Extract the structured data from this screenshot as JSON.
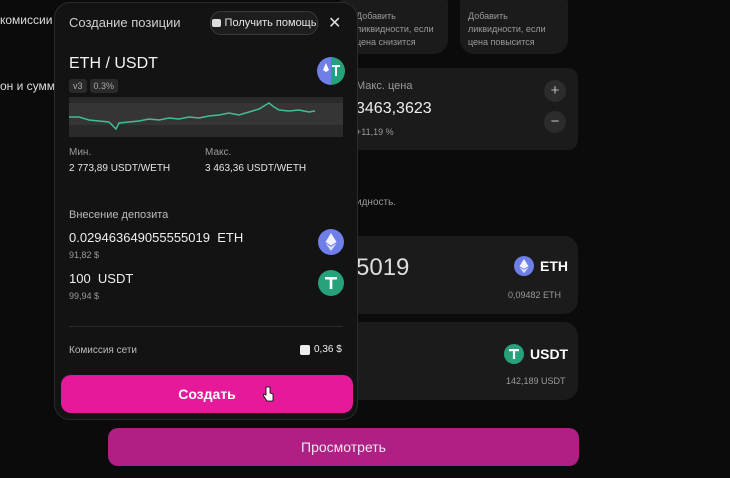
{
  "background": {
    "left_text_1": "комиссии",
    "left_text_2": "он и сумм",
    "card_low_text": "Добавить ликвидности, если цена снизится",
    "card_high_text": "Добавить ликвидности, если цена повысится",
    "max_price_label": "Макс. цена",
    "max_price_value": "3463,3623",
    "max_price_change": "+11,19 %",
    "liquidity_text": "идность.",
    "eth_amount_partial": "5019",
    "eth_token": "ETH",
    "eth_balance": "0,09482 ETH",
    "usdt_token": "USDT",
    "usdt_balance": "142,189 USDT",
    "plus_symbol": "+",
    "minus_symbol": "−"
  },
  "modal": {
    "title": "Создание позиции",
    "help_label": "Получить помощь",
    "close_symbol": "✕",
    "pair": "ETH / USDT",
    "version": "v3",
    "fee_tier": "0.3%",
    "min_label": "Мин.",
    "min_value": "2 773,89 USDT/WETH",
    "max_label": "Макс.",
    "max_value": "3 463,36 USDT/WETH",
    "deposit_label": "Внесение депозита",
    "eth_amount": "0.029463649055555019  ETH",
    "eth_usd": "91,82 $",
    "usdt_amount": "100  USDT",
    "usdt_usd": "99,94 $",
    "network_fee_label": "Комиссия сети",
    "network_fee_value": "0,36 $",
    "create_label": "Создать"
  },
  "review_label": "Просмотреть",
  "colors": {
    "accent": "#e5199a",
    "accent_dim": "#b01f84",
    "chart_line": "#3fbf8f"
  }
}
